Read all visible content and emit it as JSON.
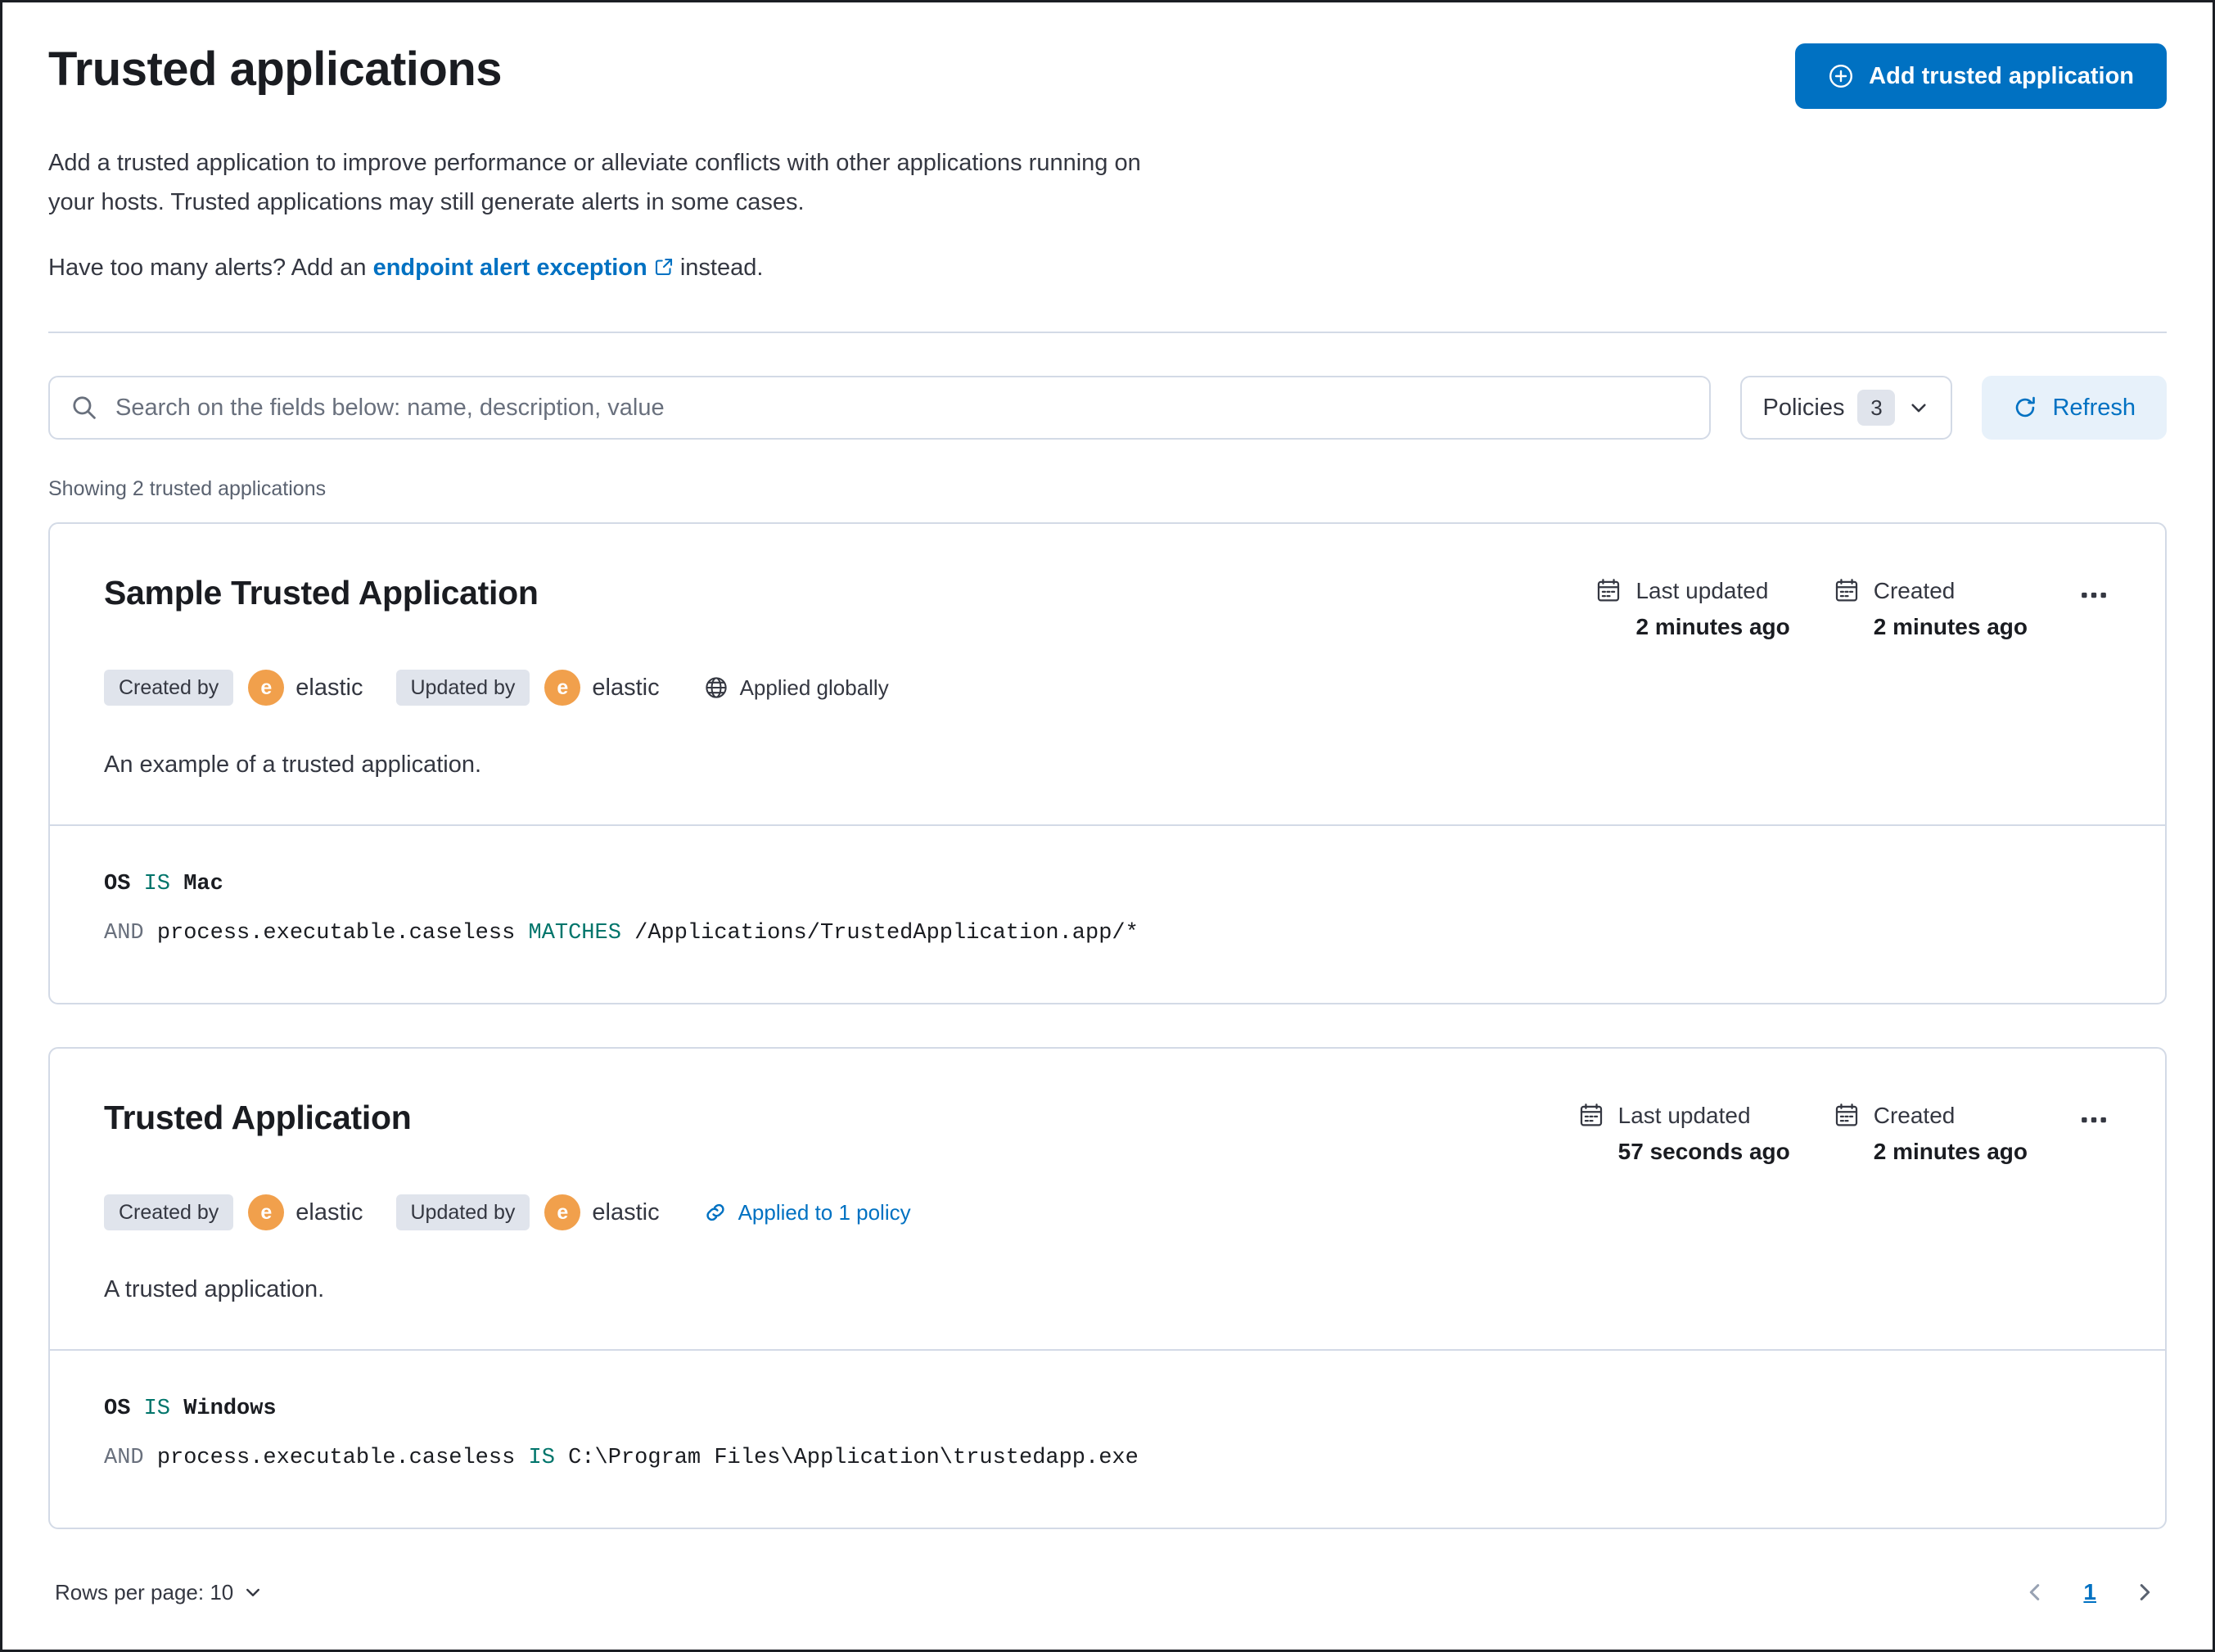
{
  "page": {
    "title": "Trusted applications",
    "description_line1": "Add a trusted application to improve performance or alleviate conflicts with other applications running on",
    "description_line2": "your hosts. Trusted applications may still generate alerts in some cases.",
    "alerts_prefix": "Have too many alerts? Add an",
    "alerts_link": "endpoint alert exception",
    "alerts_suffix": "instead.",
    "showing_text": "Showing 2 trusted applications"
  },
  "header": {
    "add_button_label": "Add trusted application"
  },
  "toolbar": {
    "search_placeholder": "Search on the fields below: name, description, value",
    "policies_label": "Policies",
    "policies_count": "3",
    "refresh_label": "Refresh"
  },
  "cards": [
    {
      "title": "Sample Trusted Application",
      "created_by_label": "Created by",
      "created_by_user": "elastic",
      "updated_by_label": "Updated by",
      "updated_by_user": "elastic",
      "avatar_initial": "e",
      "scope_label": "Applied globally",
      "last_updated_label": "Last updated",
      "last_updated_value": "2 minutes ago",
      "created_label": "Created",
      "created_value": "2 minutes ago",
      "description": "An example of a trusted application.",
      "criteria": {
        "line1": {
          "field": "OS",
          "op": "IS",
          "value": "Mac"
        },
        "line2": {
          "conj": "AND",
          "field": "process.executable.caseless",
          "op": "MATCHES",
          "value": "/Applications/TrustedApplication.app/*"
        }
      }
    },
    {
      "title": "Trusted Application",
      "created_by_label": "Created by",
      "created_by_user": "elastic",
      "updated_by_label": "Updated by",
      "updated_by_user": "elastic",
      "avatar_initial": "e",
      "scope_label": "Applied to 1 policy",
      "last_updated_label": "Last updated",
      "last_updated_value": "57 seconds ago",
      "created_label": "Created",
      "created_value": "2 minutes ago",
      "description": "A trusted application.",
      "criteria": {
        "line1": {
          "field": "OS",
          "op": "IS",
          "value": "Windows"
        },
        "line2": {
          "conj": "AND",
          "field": "process.executable.caseless",
          "op": "IS",
          "value": "C:\\Program Files\\Application\\trustedapp.exe"
        }
      }
    }
  ],
  "footer": {
    "rows_per_page_label": "Rows per page: 10",
    "page_number": "1"
  },
  "icons": {
    "add": "plus-in-circle",
    "external_link": "box-with-arrow",
    "search": "magnifier",
    "policies_caret": "chevron-down",
    "refresh": "circular-arrow",
    "calendar": "calendar",
    "globe": "globe",
    "policy_link": "chain-link",
    "card_actions": "boxes-horizontal",
    "pagination_prev": "chevron-left",
    "pagination_next": "chevron-right"
  },
  "colors": {
    "primary": "#0071c2",
    "primary_light_bg": "#e7f1fa",
    "text": "#343741",
    "subdued": "#69707d",
    "border": "#d3dae6",
    "badge_bg": "#e0e4ec",
    "avatar_orange": "#f1a04c",
    "operator_teal": "#00756b"
  }
}
